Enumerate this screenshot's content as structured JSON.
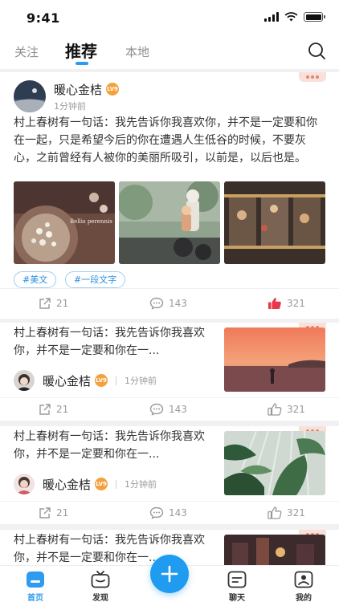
{
  "status_bar": {
    "time": "9:41"
  },
  "header": {
    "tabs": [
      {
        "label": "关注"
      },
      {
        "label": "推荐"
      },
      {
        "label": "本地"
      }
    ]
  },
  "feed": {
    "posts": [
      {
        "author": "暖心金桔",
        "level": "LV9",
        "time": "1分钟前",
        "text": "村上春树有一句话：我先告诉你我喜欢你，并不是一定要和你在一起，只是希望今后的你在遭遇人生低谷的时候，不要灰心，之前曾经有人被你的美丽所吸引，以前是，以后也是。",
        "image_caption": "Bellis perennis",
        "topics": [
          "#美文",
          "#一段文字"
        ],
        "shares": "21",
        "comments": "143",
        "likes": "321",
        "liked": true
      },
      {
        "author": "暖心金桔",
        "level": "LV9",
        "time": "1分钟前",
        "text": "村上春树有一句话：我先告诉你我喜欢你，并不是一定要和你在一...",
        "shares": "21",
        "comments": "143",
        "likes": "321",
        "liked": false
      },
      {
        "author": "暖心金桔",
        "level": "LV9",
        "time": "1分钟前",
        "text": "村上春树有一句话：我先告诉你我喜欢你，并不是一定要和你在一...",
        "shares": "21",
        "comments": "143",
        "likes": "321",
        "liked": false
      },
      {
        "text": "村上春树有一句话：我先告诉你我喜欢你，并不是一定要和你在一..."
      }
    ]
  },
  "tabbar": {
    "items": [
      {
        "label": "首页",
        "icon": "home-icon"
      },
      {
        "label": "发现",
        "icon": "tv-icon"
      },
      {
        "label": "聊天",
        "icon": "chat-icon"
      },
      {
        "label": "我的",
        "icon": "profile-icon"
      }
    ]
  },
  "colors": {
    "accent": "#1f9bf0",
    "like": "#e8374a",
    "badge": "#f4a13c"
  }
}
